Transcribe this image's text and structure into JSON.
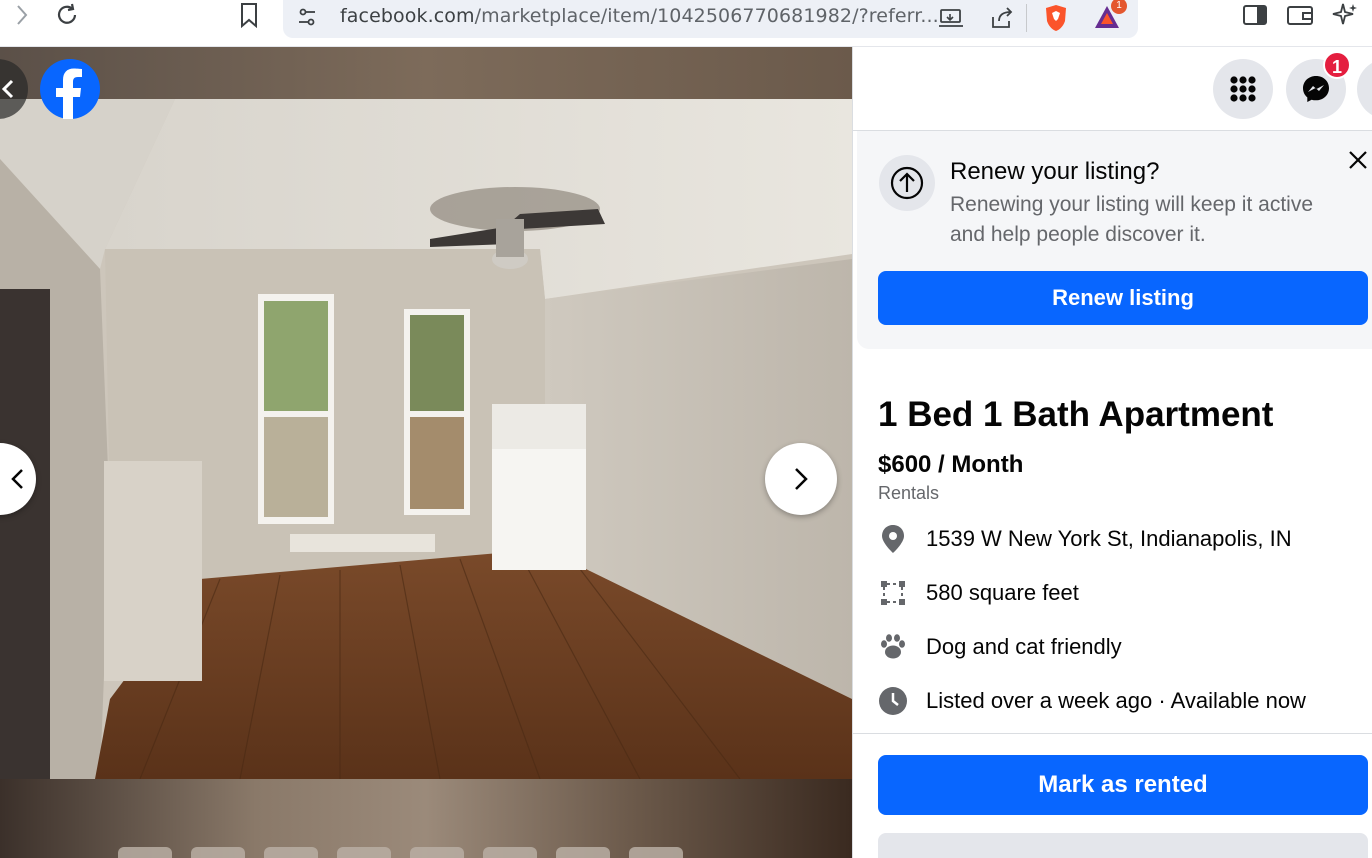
{
  "browser": {
    "url_main": "facebook.com",
    "url_rest": "/marketplace/item/1042506770681982/?referr...",
    "extension_badge": "1"
  },
  "header": {
    "messenger_badge": "1"
  },
  "renew": {
    "title": "Renew your listing?",
    "description": "Renewing your listing will keep it active and help people discover it.",
    "button_label": "Renew listing"
  },
  "listing": {
    "title": "1 Bed 1 Bath Apartment",
    "price": "$600 / Month",
    "category": "Rentals",
    "details": [
      {
        "icon": "location-pin-icon",
        "text": "1539 W New York St, Indianapolis, IN"
      },
      {
        "icon": "square-footage-icon",
        "text": "580 square feet"
      },
      {
        "icon": "paw-icon",
        "text": "Dog and cat friendly"
      },
      {
        "icon": "clock-icon",
        "text": "Listed over a week ago · Available now"
      }
    ],
    "mark_rented_label": "Mark as rented"
  },
  "colors": {
    "brand_blue": "#0866ff",
    "badge_red": "#e41e3f"
  }
}
